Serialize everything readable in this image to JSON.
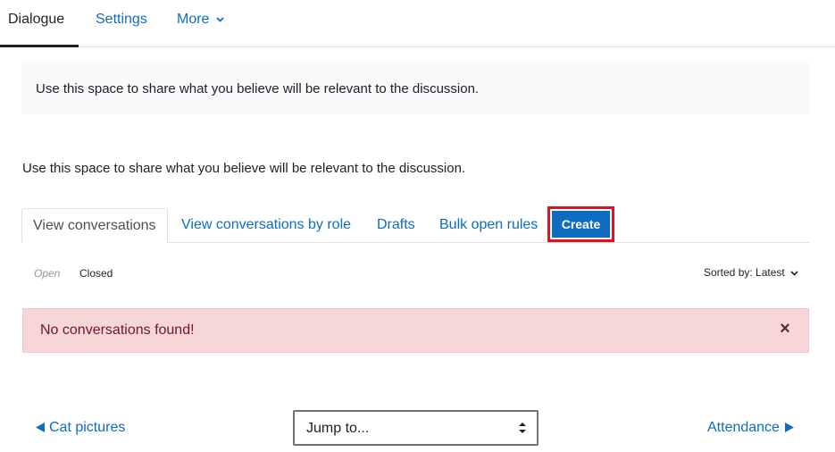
{
  "nav": {
    "items": [
      {
        "label": "Dialogue"
      },
      {
        "label": "Settings"
      },
      {
        "label": "More"
      }
    ]
  },
  "intro": {
    "box_text": "Use this space to share what you believe will be relevant to the discussion.",
    "text": "Use this space to share what you believe will be relevant to the discussion."
  },
  "tabs": {
    "items": [
      {
        "label": "View conversations"
      },
      {
        "label": "View conversations by role"
      },
      {
        "label": "Drafts"
      },
      {
        "label": "Bulk open rules"
      }
    ],
    "create_label": "Create"
  },
  "filters": {
    "open_label": "Open",
    "closed_label": "Closed",
    "sort_label": "Sorted by: Latest"
  },
  "alert": {
    "message": "No conversations found!",
    "close_glyph": "×"
  },
  "footer": {
    "prev_label": "Cat pictures",
    "next_label": "Attendance",
    "jump_value": "Jump to..."
  },
  "colors": {
    "link": "#0f6cbf",
    "create_highlight": "#e3101e",
    "alert_bg": "#f7d6d9"
  }
}
